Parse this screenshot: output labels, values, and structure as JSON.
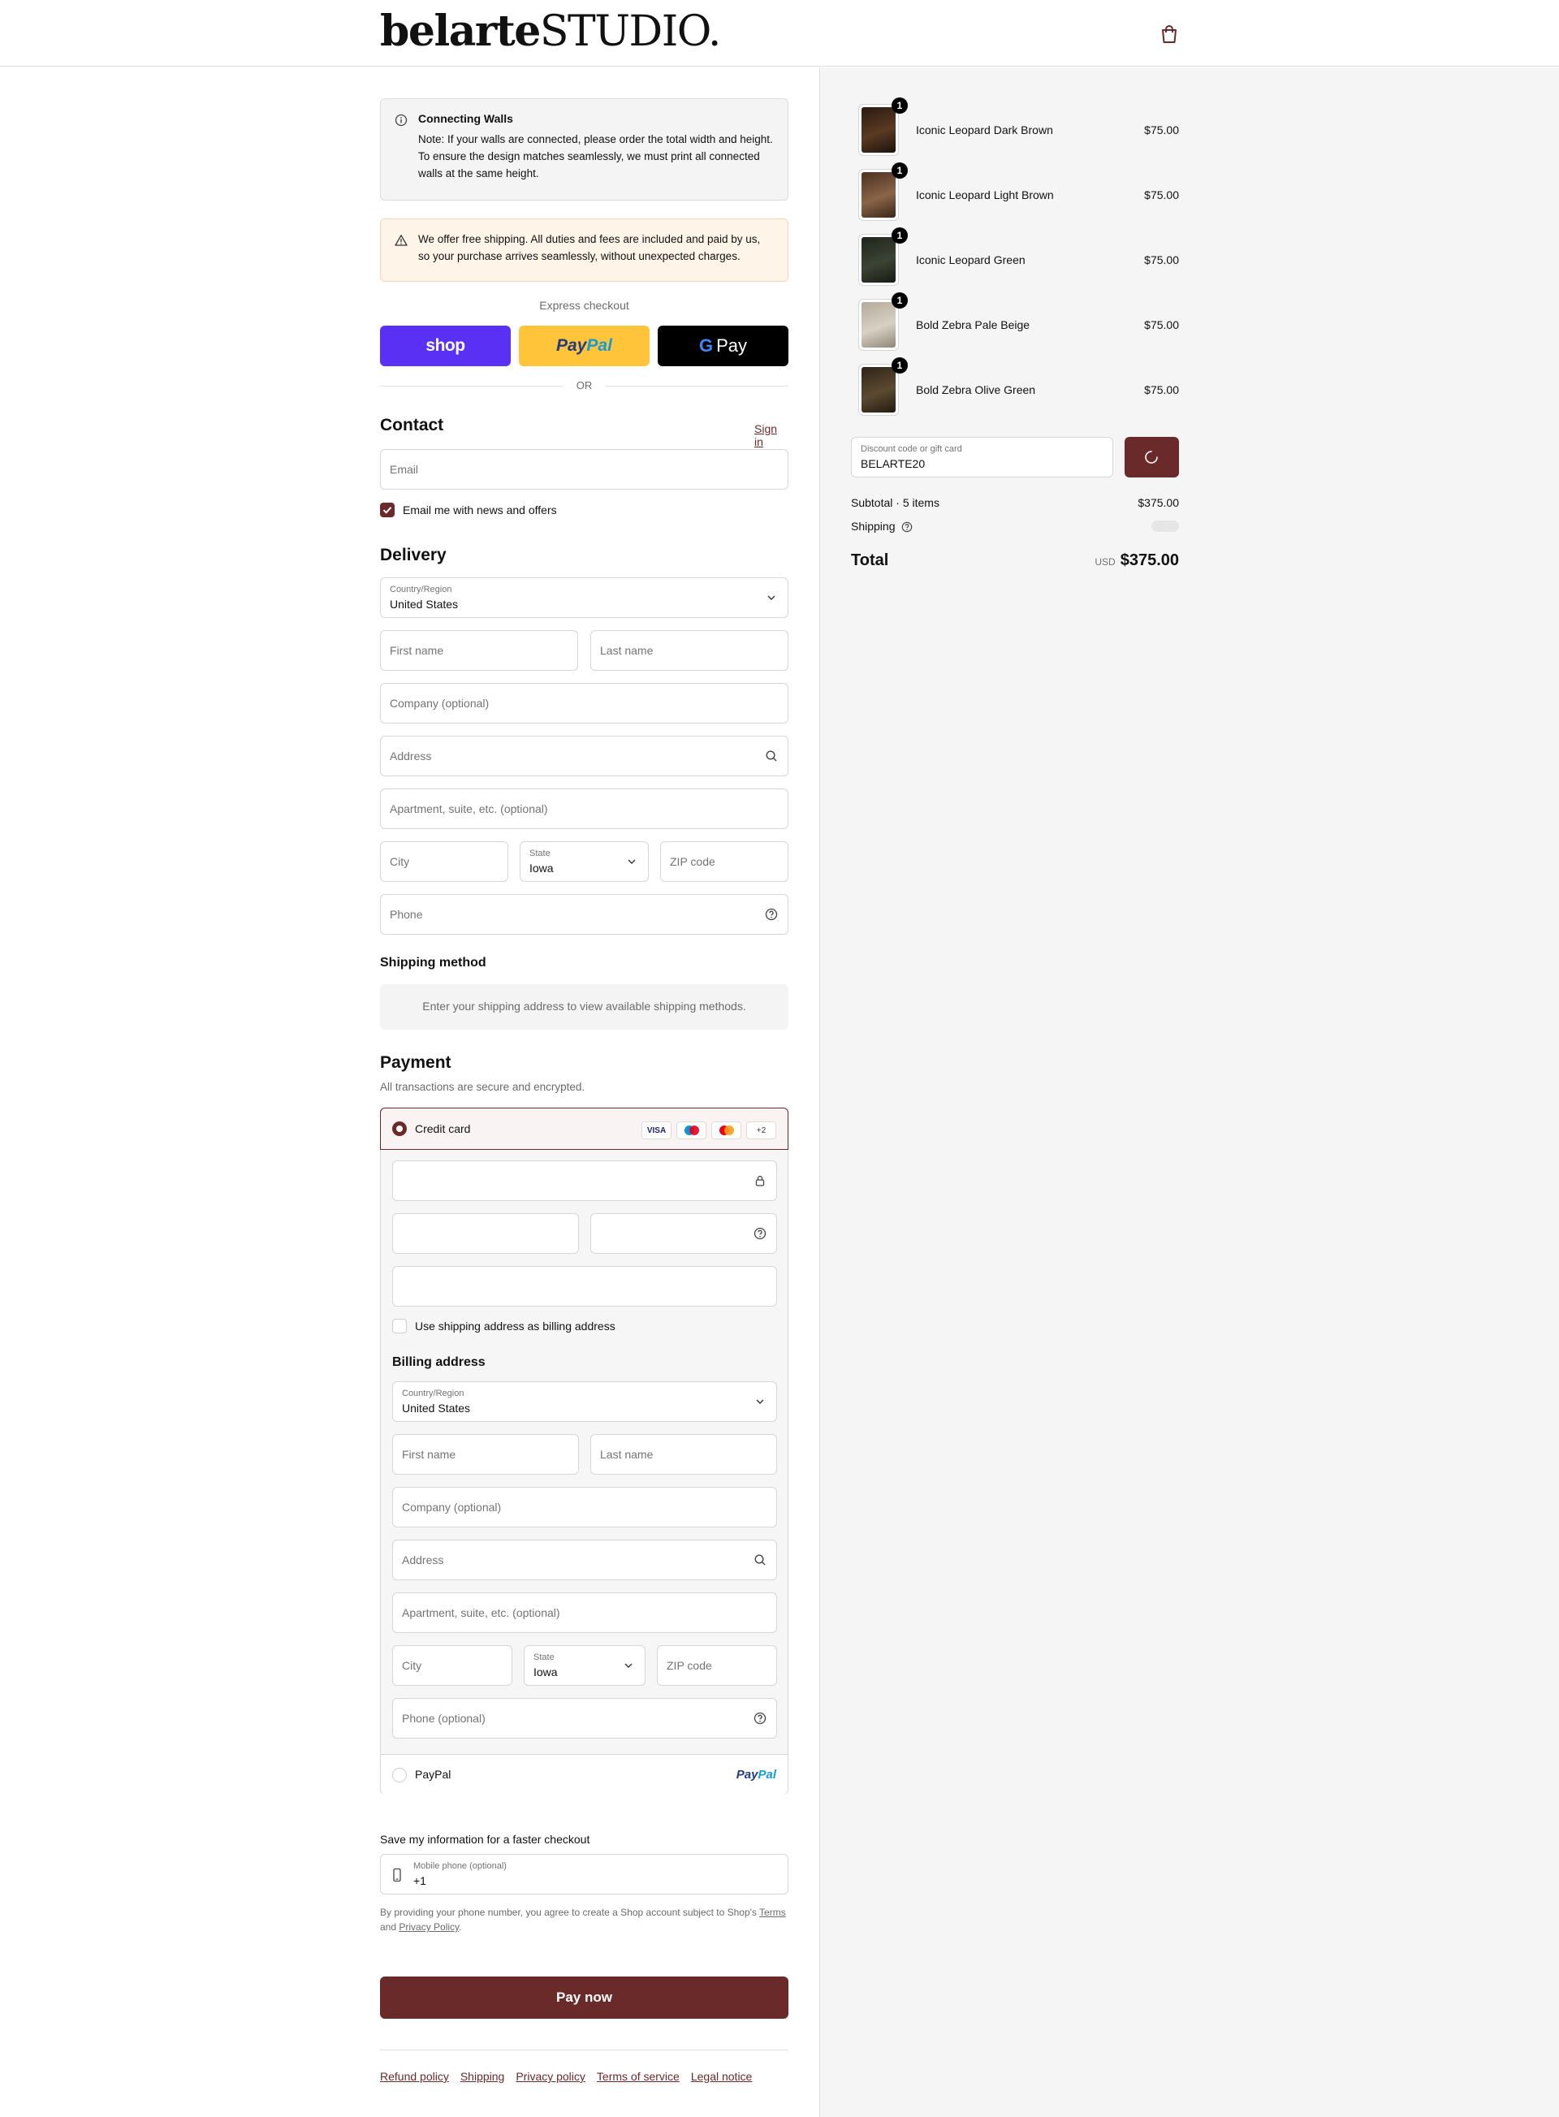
{
  "brand": {
    "logo_bold": "belarte",
    "logo_rest": "STUDIO."
  },
  "notices": {
    "info_title": "Connecting Walls",
    "info_text": "Note: If your walls are connected, please order the total width and height. To ensure the design matches seamlessly, we must print all connected walls at the same height.",
    "shipping_text": "We offer free shipping. All duties and fees are included and paid by us, so your purchase arrives seamlessly, without unexpected charges."
  },
  "express": {
    "label": "Express checkout",
    "shop": "shop",
    "paypal_a": "Pay",
    "paypal_b": "Pal",
    "gpay_g": "G",
    "gpay_text": "Pay",
    "or": "OR"
  },
  "contact": {
    "heading": "Contact",
    "sign_in": "Sign in",
    "email_placeholder": "Email",
    "news_label": "Email me with news and offers"
  },
  "delivery": {
    "heading": "Delivery",
    "country_label": "Country/Region",
    "country_value": "United States",
    "first_name": "First name",
    "last_name": "Last name",
    "company": "Company (optional)",
    "address": "Address",
    "apartment": "Apartment, suite, etc. (optional)",
    "city": "City",
    "state_label": "State",
    "state_value": "Iowa",
    "zip": "ZIP code",
    "phone": "Phone"
  },
  "shipping_method": {
    "heading": "Shipping method",
    "message": "Enter your shipping address to view available shipping methods."
  },
  "payment": {
    "heading": "Payment",
    "subtitle": "All transactions are secure and encrypted.",
    "credit_card": "Credit card",
    "card_logos": [
      "VISA",
      "",
      "",
      "+2"
    ],
    "billing_same": "Use shipping address as billing address",
    "billing_heading": "Billing address",
    "billing": {
      "country_label": "Country/Region",
      "country_value": "United States",
      "first_name": "First name",
      "last_name": "Last name",
      "company": "Company (optional)",
      "address": "Address",
      "apartment": "Apartment, suite, etc. (optional)",
      "city": "City",
      "state_label": "State",
      "state_value": "Iowa",
      "zip": "ZIP code",
      "phone": "Phone (optional)"
    },
    "paypal": "PayPal",
    "paypal_logo_a": "Pay",
    "paypal_logo_b": "Pal"
  },
  "save_info": {
    "heading": "Save my information for a faster checkout",
    "mobile_label": "Mobile phone (optional)",
    "mobile_value": "+1",
    "terms_prefix": "By providing your phone number, you agree to create a Shop account subject to Shop's",
    "terms_link": "Terms",
    "terms_and": "and",
    "privacy_link": "Privacy Policy",
    "terms_suffix": "."
  },
  "pay_now": "Pay now",
  "footer_links": [
    "Refund policy",
    "Shipping",
    "Privacy policy",
    "Terms of service",
    "Legal notice"
  ],
  "cart": {
    "items": [
      {
        "name": "Iconic Leopard Dark Brown",
        "price": "$75.00",
        "qty": "1"
      },
      {
        "name": "Iconic Leopard Light Brown",
        "price": "$75.00",
        "qty": "1"
      },
      {
        "name": "Iconic Leopard Green",
        "price": "$75.00",
        "qty": "1"
      },
      {
        "name": "Bold Zebra Pale Beige",
        "price": "$75.00",
        "qty": "1"
      },
      {
        "name": "Bold Zebra Olive Green",
        "price": "$75.00",
        "qty": "1"
      }
    ],
    "discount_label": "Discount code or gift card",
    "discount_value": "BELARTE20",
    "subtotal_label": "Subtotal · 5 items",
    "subtotal_value": "$375.00",
    "shipping_label": "Shipping",
    "total_label": "Total",
    "currency": "USD",
    "total_value": "$375.00"
  },
  "colors": {
    "accent": "#6a2a2a",
    "shop": "#5a31f4",
    "paypal": "#ffc439"
  }
}
